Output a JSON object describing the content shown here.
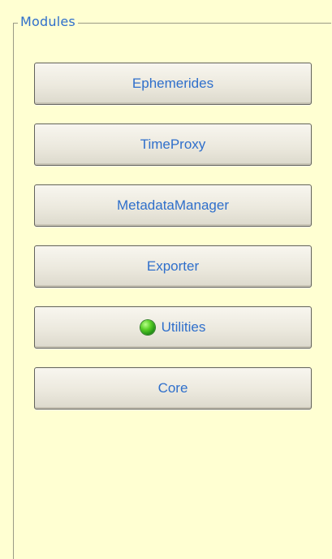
{
  "panel": {
    "title": "Modules"
  },
  "buttons": [
    {
      "label": "Ephemerides",
      "status": ""
    },
    {
      "label": "TimeProxy",
      "status": ""
    },
    {
      "label": "MetadataManager",
      "status": ""
    },
    {
      "label": "Exporter",
      "status": ""
    },
    {
      "label": "Utilities",
      "status": "green-status-light-icon"
    },
    {
      "label": "Core",
      "status": ""
    }
  ],
  "colors": {
    "background": "#ffffd2",
    "text": "#2f6fcb",
    "status_green": "#57cf25"
  }
}
